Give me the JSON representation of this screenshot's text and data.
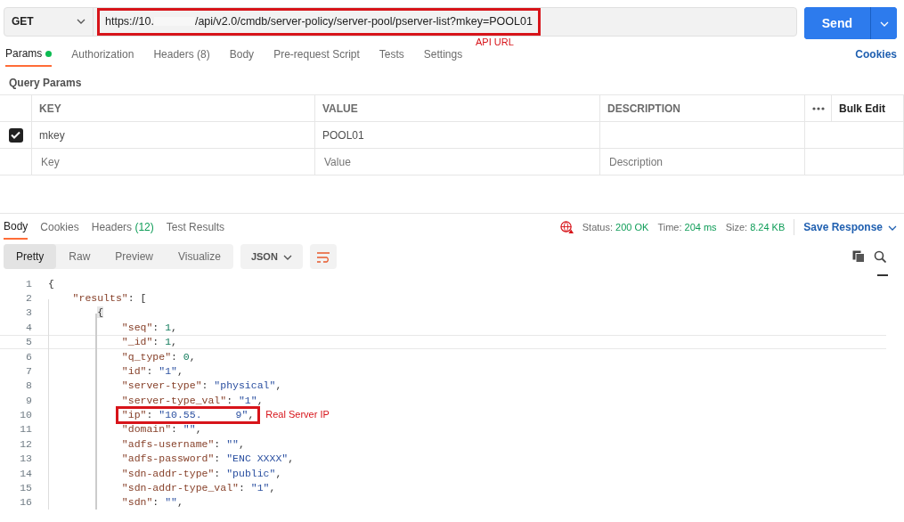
{
  "request": {
    "method": "GET",
    "url_start": "https://10.",
    "url_end": "/api/v2.0/cmdb/server-policy/server-pool/pserver-list?mkey=POOL01",
    "url_redacted": true,
    "url_annotation": "API URL",
    "send": "Send"
  },
  "request_tabs": [
    {
      "label": "Params",
      "indicator": true,
      "selected": true
    },
    {
      "label": "Authorization",
      "indicator": false,
      "selected": false
    },
    {
      "label": "Headers",
      "count": "(8)",
      "indicator": false,
      "selected": false
    },
    {
      "label": "Body",
      "indicator": false,
      "selected": false
    },
    {
      "label": "Pre-request Script",
      "indicator": false,
      "selected": false
    },
    {
      "label": "Tests",
      "indicator": false,
      "selected": false
    },
    {
      "label": "Settings",
      "indicator": false,
      "selected": false
    }
  ],
  "cookies_link": "Cookies",
  "query_params": {
    "title": "Query Params",
    "columns": [
      "KEY",
      "VALUE",
      "DESCRIPTION"
    ],
    "bulk_edit": "Bulk Edit",
    "rows": [
      {
        "checked": true,
        "key": "mkey",
        "value": "POOL01"
      }
    ],
    "new_row": {
      "key": {
        "placeholder": "Key"
      },
      "value": {
        "placeholder": "Value"
      },
      "description": {
        "placeholder": "Description"
      }
    }
  },
  "response_tabs": [
    {
      "label": "Body",
      "selected": true
    },
    {
      "label": "Cookies",
      "selected": false
    },
    {
      "label": "Headers",
      "count": "(12)",
      "selected": false
    },
    {
      "label": "Test Results",
      "selected": false
    }
  ],
  "status": [
    {
      "label": "Status:",
      "value": "200 OK"
    },
    {
      "label": "Time:",
      "value": "204 ms"
    },
    {
      "label": "Size:",
      "value": "8.24 KB"
    }
  ],
  "save_response": "Save Response",
  "view_modes": [
    {
      "label": "Pretty",
      "selected": true
    },
    {
      "label": "Raw",
      "selected": false
    },
    {
      "label": "Preview",
      "selected": false
    },
    {
      "label": "Visualize",
      "selected": false
    }
  ],
  "format": "JSON",
  "code_lines": [
    {
      "number": "1",
      "kind": "open",
      "current": false,
      "tokens": [
        {
          "kind": "punct",
          "text": "{"
        }
      ]
    },
    {
      "number": "2",
      "kind": "array",
      "current": false,
      "tokens": [
        {
          "kind": "key",
          "text": "\"results\""
        },
        {
          "kind": "punct",
          "text": ": ["
        }
      ]
    },
    {
      "number": "3",
      "kind": "inner",
      "current": false,
      "tokens": [
        {
          "kind": "cursor",
          "text": "{"
        }
      ]
    },
    {
      "number": "4",
      "kind": "pair",
      "current": false,
      "tokens": [
        {
          "kind": "key",
          "text": "\"seq\""
        },
        {
          "kind": "punct",
          "text": ": "
        },
        {
          "kind": "number",
          "text": "1"
        },
        {
          "kind": "punct",
          "text": ","
        }
      ]
    },
    {
      "number": "5",
      "kind": "pair",
      "current": true,
      "tokens": [
        {
          "kind": "key",
          "text": "\"_id\""
        },
        {
          "kind": "punct",
          "text": ": "
        },
        {
          "kind": "number",
          "text": "1"
        },
        {
          "kind": "punct",
          "text": ","
        }
      ]
    },
    {
      "number": "6",
      "kind": "pair",
      "current": false,
      "tokens": [
        {
          "kind": "key",
          "text": "\"q_type\""
        },
        {
          "kind": "punct",
          "text": ": "
        },
        {
          "kind": "number",
          "text": "0"
        },
        {
          "kind": "punct",
          "text": ","
        }
      ]
    },
    {
      "number": "7",
      "kind": "pair",
      "current": false,
      "tokens": [
        {
          "kind": "key",
          "text": "\"id\""
        },
        {
          "kind": "punct",
          "text": ": "
        },
        {
          "kind": "string",
          "text": "\"1\""
        },
        {
          "kind": "punct",
          "text": ","
        }
      ]
    },
    {
      "number": "8",
      "kind": "pair",
      "current": false,
      "tokens": [
        {
          "kind": "key",
          "text": "\"server-type\""
        },
        {
          "kind": "punct",
          "text": ": "
        },
        {
          "kind": "string",
          "text": "\"physical\""
        },
        {
          "kind": "punct",
          "text": ","
        }
      ]
    },
    {
      "number": "9",
      "kind": "pair",
      "current": false,
      "tokens": [
        {
          "kind": "key",
          "text": "\"server-type_val\""
        },
        {
          "kind": "punct",
          "text": ": "
        },
        {
          "kind": "string",
          "text": "\"1\""
        },
        {
          "kind": "punct",
          "text": ","
        }
      ]
    },
    {
      "number": "10",
      "kind": "pair",
      "current": false,
      "annotation": "Real Server IP",
      "tokens": [
        {
          "kind": "key",
          "text": "\"ip\""
        },
        {
          "kind": "punct",
          "text": ": "
        },
        {
          "kind": "string",
          "text": "\"10.55."
        },
        {
          "kind": "redacted"
        },
        {
          "kind": "string",
          "text": "9\""
        },
        {
          "kind": "punct",
          "text": ","
        }
      ]
    },
    {
      "number": "11",
      "kind": "pair",
      "current": false,
      "tokens": [
        {
          "kind": "key",
          "text": "\"domain\""
        },
        {
          "kind": "punct",
          "text": ": "
        },
        {
          "kind": "string",
          "text": "\"\""
        },
        {
          "kind": "punct",
          "text": ","
        }
      ]
    },
    {
      "number": "12",
      "kind": "pair",
      "current": false,
      "tokens": [
        {
          "kind": "key",
          "text": "\"adfs-username\""
        },
        {
          "kind": "punct",
          "text": ": "
        },
        {
          "kind": "string",
          "text": "\"\""
        },
        {
          "kind": "punct",
          "text": ","
        }
      ]
    },
    {
      "number": "13",
      "kind": "pair",
      "current": false,
      "tokens": [
        {
          "kind": "key",
          "text": "\"adfs-password\""
        },
        {
          "kind": "punct",
          "text": ": "
        },
        {
          "kind": "string",
          "text": "\"ENC XXXX\""
        },
        {
          "kind": "punct",
          "text": ","
        }
      ]
    },
    {
      "number": "14",
      "kind": "pair",
      "current": false,
      "tokens": [
        {
          "kind": "key",
          "text": "\"sdn-addr-type\""
        },
        {
          "kind": "punct",
          "text": ": "
        },
        {
          "kind": "string",
          "text": "\"public\""
        },
        {
          "kind": "punct",
          "text": ","
        }
      ]
    },
    {
      "number": "15",
      "kind": "pair",
      "current": false,
      "tokens": [
        {
          "kind": "key",
          "text": "\"sdn-addr-type_val\""
        },
        {
          "kind": "punct",
          "text": ": "
        },
        {
          "kind": "string",
          "text": "\"1\""
        },
        {
          "kind": "punct",
          "text": ","
        }
      ]
    },
    {
      "number": "16",
      "kind": "pair",
      "current": false,
      "tokens": [
        {
          "kind": "key",
          "text": "\"sdn\""
        },
        {
          "kind": "punct",
          "text": ": "
        },
        {
          "kind": "string",
          "text": "\"\""
        },
        {
          "kind": "punct",
          "text": ","
        }
      ]
    }
  ]
}
